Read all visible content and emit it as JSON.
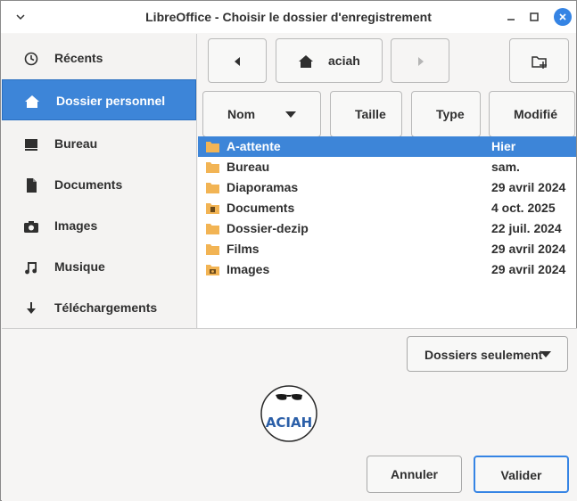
{
  "window": {
    "title": "LibreOffice - Choisir le dossier d'enregistrement"
  },
  "sidebar": {
    "items": [
      {
        "label": "Récents",
        "icon": "clock-icon"
      },
      {
        "label": "Dossier personnel",
        "icon": "home-icon",
        "active": true
      },
      {
        "label": "Bureau",
        "icon": "desktop-icon"
      },
      {
        "label": "Documents",
        "icon": "document-icon"
      },
      {
        "label": "Images",
        "icon": "camera-icon"
      },
      {
        "label": "Musique",
        "icon": "music-icon"
      },
      {
        "label": "Téléchargements",
        "icon": "download-icon"
      }
    ]
  },
  "toolbar": {
    "path_label": "aciah"
  },
  "columns": {
    "name": "Nom",
    "size": "Taille",
    "type": "Type",
    "modified": "Modifié"
  },
  "files": [
    {
      "name": "A-attente",
      "modified": "Hier",
      "selected": true,
      "icon": "folder-icon"
    },
    {
      "name": "Bureau",
      "modified": "sam.",
      "icon": "folder-icon"
    },
    {
      "name": "Diaporamas",
      "modified": "29 avril 2024",
      "icon": "folder-icon"
    },
    {
      "name": "Documents",
      "modified": "4 oct. 2025",
      "icon": "folder-documents-icon"
    },
    {
      "name": "Dossier-dezip",
      "modified": "22 juil. 2024",
      "icon": "folder-icon"
    },
    {
      "name": "Films",
      "modified": "29 avril 2024",
      "icon": "folder-icon"
    },
    {
      "name": "Images",
      "modified": "29 avril 2024",
      "icon": "folder-pictures-icon"
    }
  ],
  "filter": {
    "selected": "Dossiers seulement"
  },
  "buttons": {
    "cancel": "Annuler",
    "confirm": "Valider"
  },
  "logo": {
    "text": "ACIAH"
  },
  "colors": {
    "accent": "#3d85d8",
    "folder": "#f2b454"
  }
}
